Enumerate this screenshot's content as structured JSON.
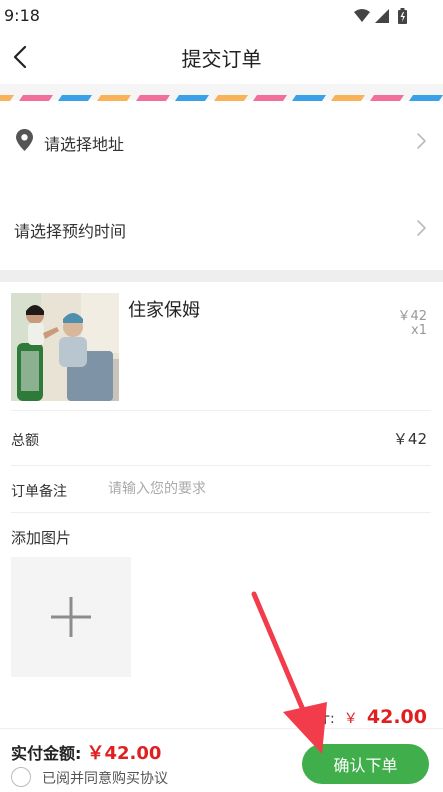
{
  "status_bar": {
    "time": "9:18",
    "icons": [
      "wifi-icon",
      "signal-icon",
      "battery-icon"
    ]
  },
  "nav": {
    "title": "提交订单",
    "back_icon": "back-arrow-icon"
  },
  "address": {
    "icon": "location-pin-icon",
    "placeholder": "请选择地址"
  },
  "appointment": {
    "placeholder": "请选择预约时间"
  },
  "product": {
    "name": "住家保姆",
    "price": "￥42",
    "quantity": "x1",
    "image": "caregiver-feeding-elderly-man-photo"
  },
  "total": {
    "label": "总额",
    "value": "￥42"
  },
  "remark": {
    "label": "订单备注",
    "placeholder": "请输入您的要求",
    "value": ""
  },
  "photos": {
    "label": "添加图片",
    "add_icon": "plus-icon"
  },
  "summary": {
    "label": "合计:",
    "currency": "￥",
    "amount": "42.00"
  },
  "bottom_bar": {
    "pay_label": "实付金额:",
    "pay_value": "￥42.00",
    "agreement": "已阅并同意购买协议",
    "confirm_button": "确认下单"
  },
  "colors": {
    "accent_green": "#3fae4b",
    "price_red": "#e02020",
    "stripe_orange": "#f8b35a",
    "stripe_pink": "#f06f9c",
    "stripe_blue": "#3aa0e8"
  }
}
